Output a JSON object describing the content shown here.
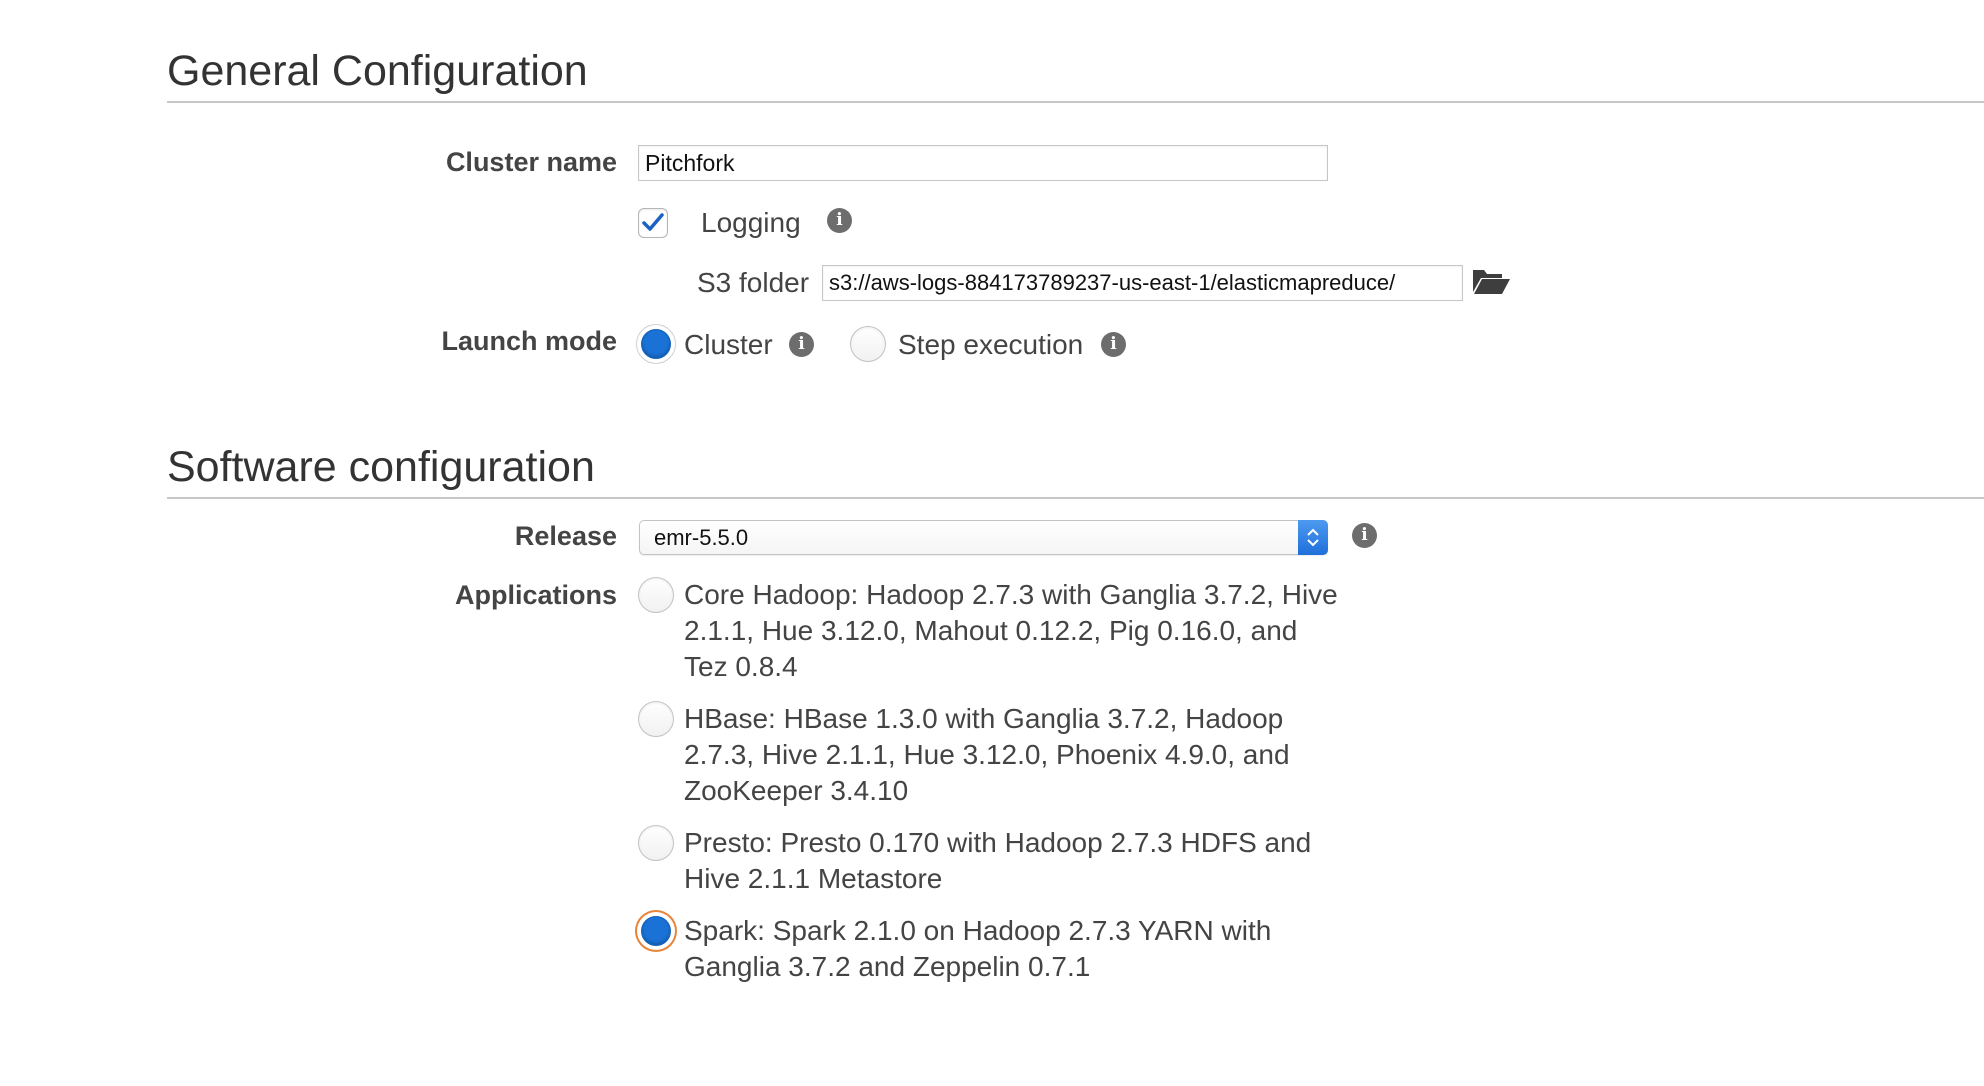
{
  "general": {
    "title": "General Configuration",
    "cluster_name_label": "Cluster name",
    "cluster_name_value": "Pitchfork",
    "logging_label": "Logging",
    "logging_checked": true,
    "s3_folder_label": "S3 folder",
    "s3_folder_value": "s3://aws-logs-884173789237-us-east-1/elasticmapreduce/",
    "launch_mode_label": "Launch mode",
    "launch_modes": [
      {
        "label": "Cluster",
        "selected": true
      },
      {
        "label": "Step execution",
        "selected": false
      }
    ]
  },
  "software": {
    "title": "Software configuration",
    "release_label": "Release",
    "release_value": "emr-5.5.0",
    "applications_label": "Applications",
    "applications": [
      {
        "text": "Core Hadoop: Hadoop 2.7.3 with Ganglia 3.7.2, Hive 2.1.1, Hue 3.12.0, Mahout 0.12.2, Pig 0.16.0, and Tez 0.8.4",
        "selected": false
      },
      {
        "text": "HBase: HBase 1.3.0 with Ganglia 3.7.2, Hadoop 2.7.3, Hive 2.1.1, Hue 3.12.0, Phoenix 4.9.0, and ZooKeeper 3.4.10",
        "selected": false
      },
      {
        "text": "Presto: Presto 0.170 with Hadoop 2.7.3 HDFS and Hive 2.1.1 Metastore",
        "selected": false
      },
      {
        "text": "Spark: Spark 2.1.0 on Hadoop 2.7.3 YARN with Ganglia 3.7.2 and Zeppelin 0.7.1",
        "selected": true
      }
    ]
  },
  "icons": {
    "info": "info-icon",
    "folder": "folder-open-icon",
    "checkmark": "checkmark-icon",
    "select_arrows": "chevron-up-down-icon"
  },
  "colors": {
    "accent_blue": "#1a72d6",
    "focus_orange": "#e8843a",
    "rule_gray": "#c8c8c8"
  }
}
